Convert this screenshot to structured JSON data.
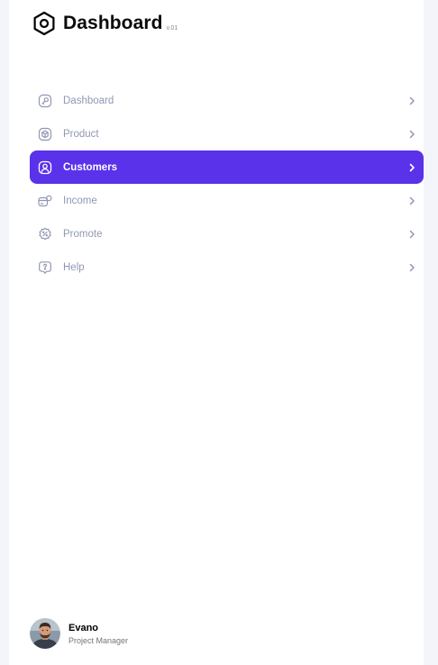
{
  "brand": {
    "title": "Dashboard",
    "version": "v.01",
    "icon": "hexagon-settings-icon"
  },
  "nav": {
    "items": [
      {
        "label": "Dashboard",
        "icon": "key-square-icon",
        "active": false
      },
      {
        "label": "Product",
        "icon": "cube-icon",
        "active": false
      },
      {
        "label": "Customers",
        "icon": "user-square-icon",
        "active": true
      },
      {
        "label": "Income",
        "icon": "wallet-money-icon",
        "active": false
      },
      {
        "label": "Promote",
        "icon": "discount-shape-icon",
        "active": false
      },
      {
        "label": "Help",
        "icon": "message-question-icon",
        "active": false
      }
    ]
  },
  "profile": {
    "name": "Evano",
    "role": "Project Manager"
  },
  "colors": {
    "accent": "#5932ea",
    "nav_text": "#9197b3",
    "sidebar_bg": "#ffffff",
    "page_bg": "#f4f5fb"
  }
}
